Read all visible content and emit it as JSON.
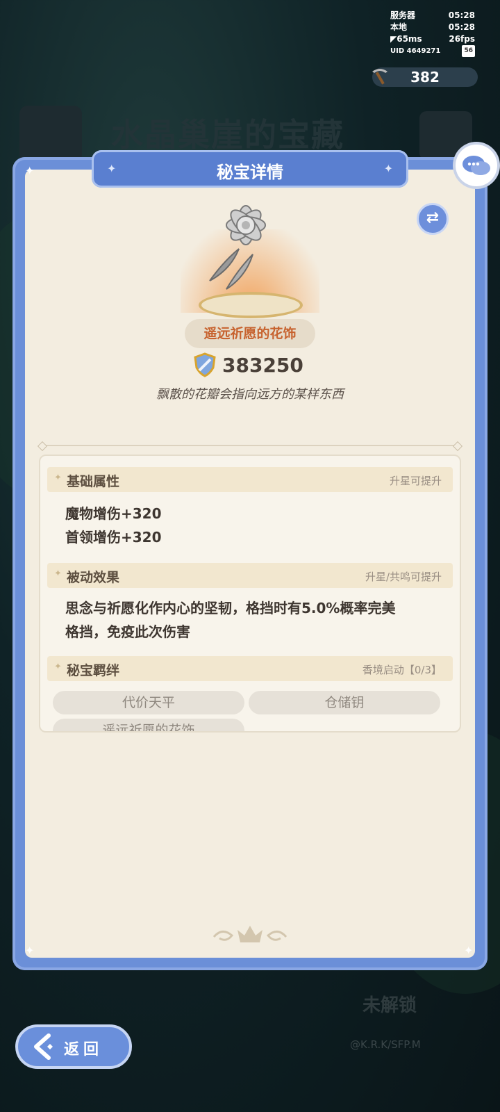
{
  "status": {
    "server_label": "服务器",
    "server_time": "05:28",
    "local_label": "本地",
    "local_time": "05:28",
    "ping": "65ms",
    "fps": "26fps",
    "uid": "UID 4649271",
    "battery": "56"
  },
  "currency": {
    "icon": "pickaxe-icon",
    "value": "382"
  },
  "background": {
    "title": "水晶巢崖的宝藏",
    "locked_text": "未解锁",
    "copyright": "@K.R.K/SFP.M"
  },
  "panel": {
    "title": "秘宝详情",
    "item_name": "遥远祈愿的花饰",
    "power": "383250",
    "description": "飘散的花瓣会指向远方的某样东西"
  },
  "sections": {
    "basic": {
      "title": "基础属性",
      "hint": "升星可提升",
      "lines": [
        "魔物增伤+320",
        "首领增伤+320"
      ]
    },
    "passive": {
      "title": "被动效果",
      "hint": "升星/共鸣可提升",
      "lines": [
        "思念与祈愿化作内心的坚韧，格挡时有5.0%概率完美",
        "格挡，免疫此次伤害"
      ]
    },
    "bond": {
      "title": "秘宝羁绊",
      "hint": "香境启动【0/3】",
      "items": [
        "代价天平",
        "仓储钥",
        "遥远祈愿的花饰"
      ]
    }
  },
  "buttons": {
    "back": "返回"
  },
  "colors": {
    "panel_blue": "#6b8fd8",
    "parchment": "#f3ede0",
    "item_name": "#c7622e"
  }
}
